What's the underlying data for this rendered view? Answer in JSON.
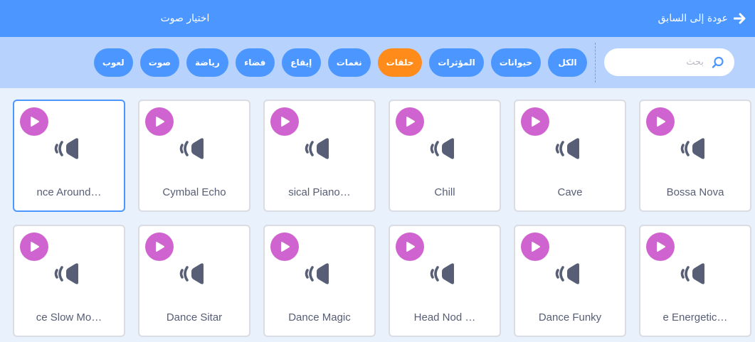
{
  "header": {
    "back_label": "عودة إلى السابق",
    "title": "اختيار صوت"
  },
  "search": {
    "placeholder": "بحث",
    "value": ""
  },
  "tags": [
    {
      "label": "الكل",
      "active": false
    },
    {
      "label": "حيوانات",
      "active": false
    },
    {
      "label": "المؤثرات",
      "active": false
    },
    {
      "label": "حلقات",
      "active": true
    },
    {
      "label": "نغمات",
      "active": false
    },
    {
      "label": "إيقاع",
      "active": false
    },
    {
      "label": "فضاء",
      "active": false
    },
    {
      "label": "رياضة",
      "active": false
    },
    {
      "label": "صوت",
      "active": false
    },
    {
      "label": "لعوب",
      "active": false
    }
  ],
  "sounds": [
    {
      "name": "Bossa Nova",
      "selected": false
    },
    {
      "name": "Cave",
      "selected": false
    },
    {
      "name": "Chill",
      "selected": false
    },
    {
      "name": "sical Piano…",
      "selected": false
    },
    {
      "name": "Cymbal Echo",
      "selected": false
    },
    {
      "name": "nce Around…",
      "selected": true
    },
    {
      "name": "e Energetic…",
      "selected": false
    },
    {
      "name": "Dance Funky",
      "selected": false
    },
    {
      "name": "Head Nod …",
      "selected": false
    },
    {
      "name": "Dance Magic",
      "selected": false
    },
    {
      "name": "Dance Sitar",
      "selected": false
    },
    {
      "name": "ce Slow Mo…",
      "selected": false
    }
  ],
  "colors": {
    "header": "#4c97ff",
    "filter_bar": "#b7d3fd",
    "tag": "#4c97ff",
    "tag_active": "#ff8c1a",
    "play_button": "#cf63cf",
    "speaker": "#575e75",
    "background": "#e9f1fc"
  }
}
